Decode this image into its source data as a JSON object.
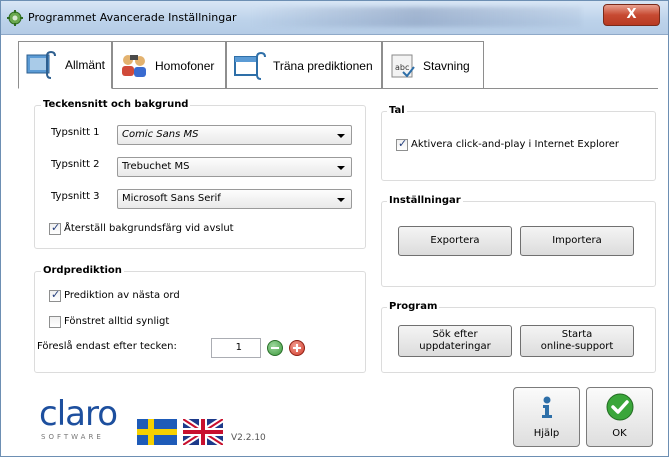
{
  "window": {
    "title": "Programmet Avancerade Inställningar",
    "close_label": "X"
  },
  "tabs": [
    {
      "label": "Allmänt",
      "icon": "settings-monitor-icon",
      "active": true
    },
    {
      "label": "Homofoner",
      "icon": "people-icon",
      "active": false
    },
    {
      "label": "Träna prediktionen",
      "icon": "window-train-icon",
      "active": false
    },
    {
      "label": "Stavning",
      "icon": "abc-spelling-icon",
      "active": false
    }
  ],
  "fonts_group": {
    "title": "Teckensnitt och bakgrund",
    "rows": [
      {
        "label": "Typsnitt 1",
        "value": "Comic Sans MS"
      },
      {
        "label": "Typsnitt 2",
        "value": "Trebuchet MS"
      },
      {
        "label": "Typsnitt 3",
        "value": "Microsoft Sans Serif"
      }
    ],
    "reset_bg_label": "Återställ bakgrundsfärg vid avslut",
    "reset_bg_checked": true
  },
  "prediction_group": {
    "title": "Ordprediktion",
    "next_word_label": "Prediktion av nästa ord",
    "next_word_checked": true,
    "always_visible_label": "Fönstret alltid synligt",
    "always_visible_checked": false,
    "suggest_after_label": "Föreslå endast efter tecken:",
    "suggest_after_value": "1"
  },
  "tal_group": {
    "title": "Tal",
    "click_play_label": "Aktivera click-and-play i Internet Explorer",
    "click_play_checked": true
  },
  "settings_group": {
    "title": "Inställningar",
    "export_label": "Exportera",
    "import_label": "Importera"
  },
  "program_group": {
    "title": "Program",
    "updates_label_line1": "Sök efter",
    "updates_label_line2": "uppdateringar",
    "support_label_line1": "Starta",
    "support_label_line2": "online-support"
  },
  "footer": {
    "logo_text": "claro",
    "logo_sub": "SOFTWARE",
    "version": "V2.2.10",
    "help_label": "Hjälp",
    "ok_label": "OK"
  },
  "colors": {
    "titlebar": "#bcd2ea",
    "close": "#c74a32",
    "logo_blue": "#1d4f9e",
    "ok_green": "#3aa63a",
    "minus_green": "#3c9a3c",
    "plus_red": "#d23a2a"
  }
}
